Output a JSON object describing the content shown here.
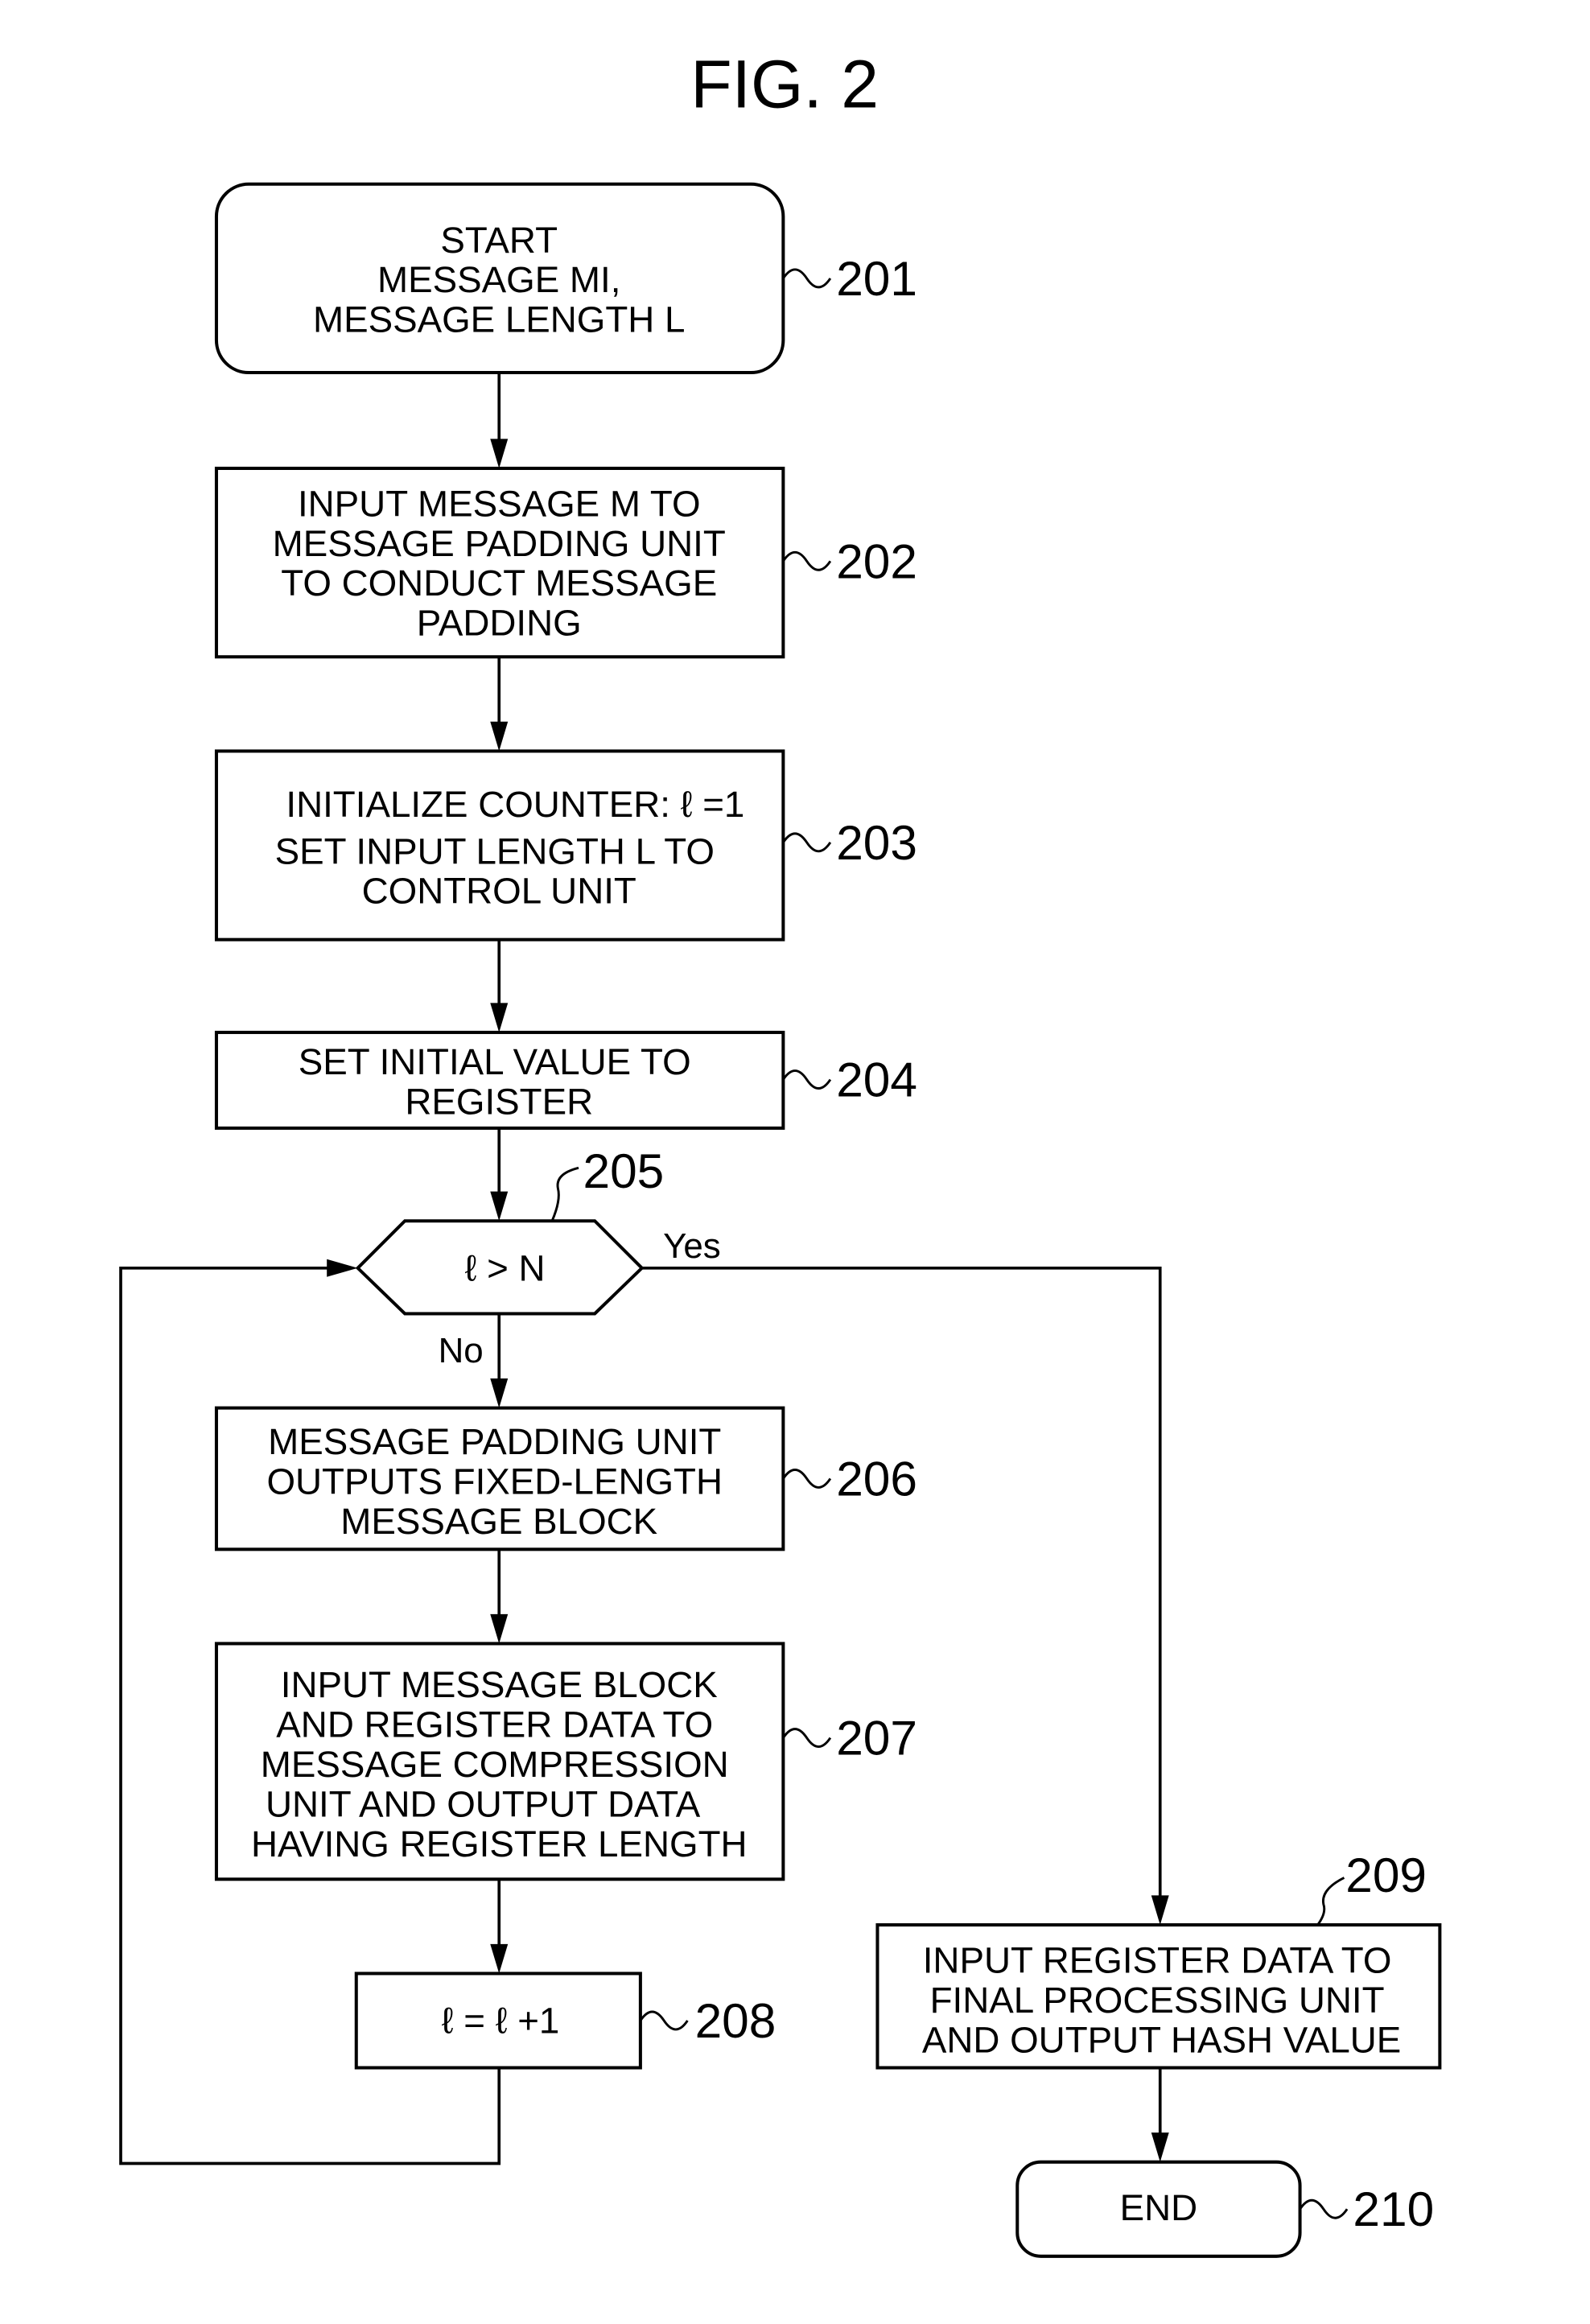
{
  "figure": {
    "title": "FIG. 2"
  },
  "steps": {
    "s201": {
      "ref": "201",
      "lines": [
        "START",
        "MESSAGE MI,",
        "MESSAGE LENGTH L"
      ]
    },
    "s202": {
      "ref": "202",
      "lines": [
        "INPUT MESSAGE M TO",
        "MESSAGE PADDING UNIT",
        "TO CONDUCT MESSAGE",
        "PADDING"
      ]
    },
    "s203": {
      "ref": "203",
      "lines": [
        "INITIALIZE COUNTER: ℓ =1",
        "SET INPUT LENGTH L TO",
        "CONTROL UNIT"
      ]
    },
    "s204": {
      "ref": "204",
      "lines": [
        "SET INITIAL VALUE TO",
        "REGISTER"
      ]
    },
    "s205": {
      "ref": "205",
      "condition": "ℓ > N",
      "yes_label": "Yes",
      "no_label": "No"
    },
    "s206": {
      "ref": "206",
      "lines": [
        "MESSAGE PADDING UNIT",
        "OUTPUTS FIXED-LENGTH",
        "MESSAGE BLOCK"
      ]
    },
    "s207": {
      "ref": "207",
      "lines": [
        "INPUT MESSAGE BLOCK",
        "AND REGISTER DATA TO",
        "MESSAGE COMPRESSION",
        "UNIT AND OUTPUT DATA",
        "HAVING REGISTER LENGTH"
      ]
    },
    "s208": {
      "ref": "208",
      "lines": [
        "ℓ = ℓ +1"
      ]
    },
    "s209": {
      "ref": "209",
      "lines": [
        "INPUT REGISTER DATA TO",
        "FINAL PROCESSING UNIT",
        "AND OUTPUT HASH VALUE"
      ]
    },
    "s210": {
      "ref": "210",
      "lines": [
        "END"
      ]
    }
  }
}
